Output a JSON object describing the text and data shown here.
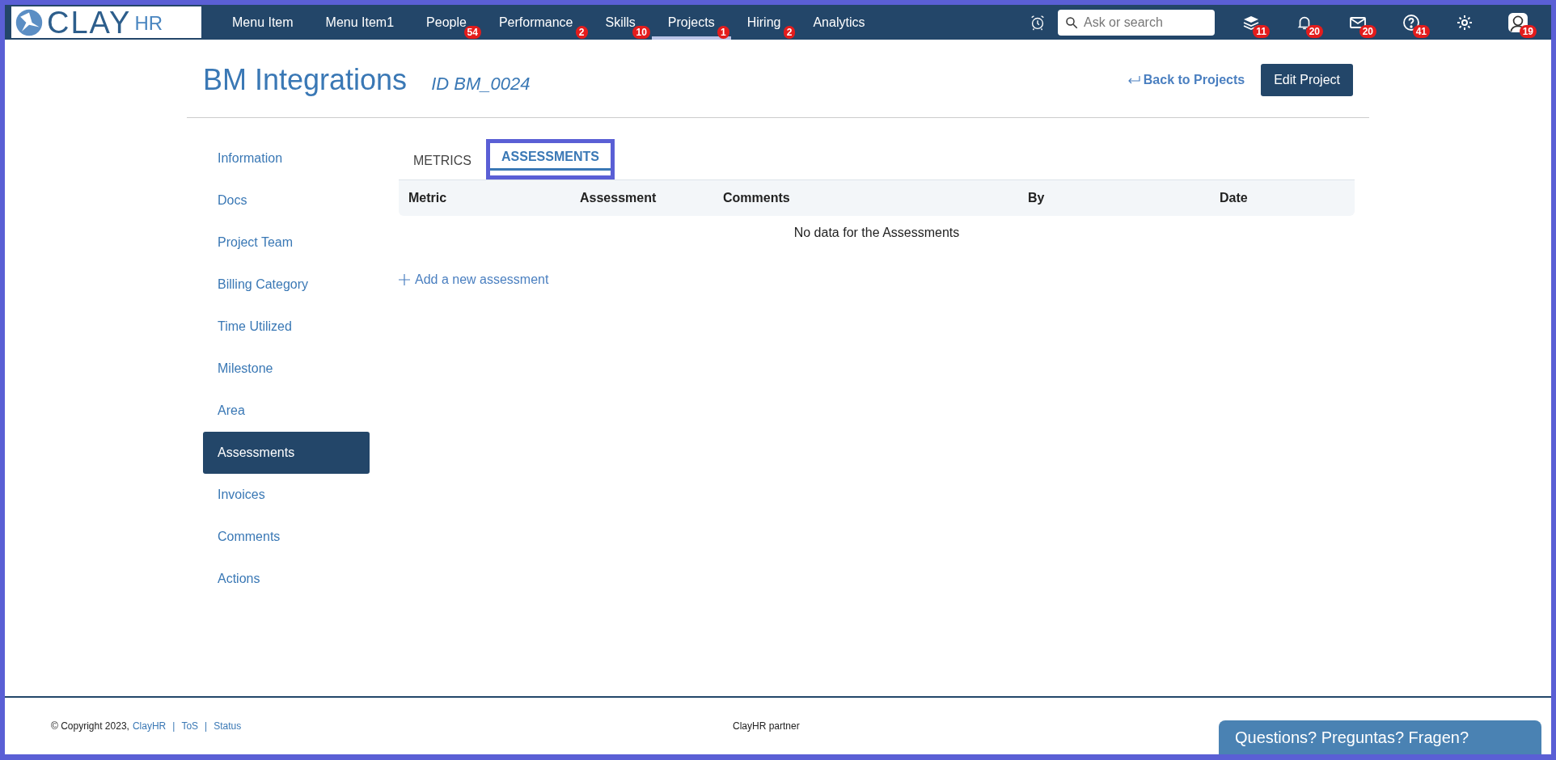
{
  "logo": {
    "word": "CLAY",
    "suffix": "HR"
  },
  "nav": [
    {
      "label": "Menu Item",
      "selected": false
    },
    {
      "label": "Menu Item1",
      "selected": false
    },
    {
      "label": "People",
      "selected": false,
      "badge": "54"
    },
    {
      "label": "Performance",
      "selected": false,
      "badge": "2"
    },
    {
      "label": "Skills",
      "selected": false,
      "badge": "10"
    },
    {
      "label": "Projects",
      "selected": true,
      "badge": "1"
    },
    {
      "label": "Hiring",
      "selected": false,
      "badge": "2"
    },
    {
      "label": "Analytics",
      "selected": false
    }
  ],
  "search": {
    "placeholder": "Ask or search"
  },
  "toolbar": [
    {
      "kind": "layers",
      "badge": "11"
    },
    {
      "kind": "bell",
      "badge": "20"
    },
    {
      "kind": "mail",
      "badge": "20"
    },
    {
      "kind": "help",
      "badge": "41"
    },
    {
      "kind": "settings"
    },
    {
      "kind": "avatar",
      "badge": "19"
    }
  ],
  "header": {
    "title": "BM Integrations",
    "id": "ID BM_0024",
    "back_link": "Back to Projects",
    "edit_button": "Edit Project"
  },
  "sidebar": [
    {
      "label": "Information",
      "selected": false
    },
    {
      "label": "Docs",
      "selected": false
    },
    {
      "label": "Project Team",
      "selected": false
    },
    {
      "label": "Billing Category",
      "selected": false
    },
    {
      "label": "Time Utilized",
      "selected": false
    },
    {
      "label": "Milestone",
      "selected": false
    },
    {
      "label": "Area",
      "selected": false
    },
    {
      "label": "Assessments",
      "selected": true
    },
    {
      "label": "Invoices",
      "selected": false
    },
    {
      "label": "Comments",
      "selected": false
    },
    {
      "label": "Actions",
      "selected": false
    }
  ],
  "tabs": [
    {
      "label": "METRICS",
      "selected": false
    },
    {
      "label": "ASSESSMENTS",
      "selected": true
    }
  ],
  "table": {
    "columns": [
      "Metric",
      "Assessment",
      "Comments",
      "By",
      "Date"
    ],
    "empty": "No data for the Assessments"
  },
  "add_link": "Add a new assessment",
  "footer": {
    "parts": [
      {
        "kind": "text",
        "text": "© Copyright 2023,"
      },
      {
        "kind": "link",
        "text": "ClayHR"
      },
      {
        "kind": "sep",
        "text": "|"
      },
      {
        "kind": "link",
        "text": "ToS"
      },
      {
        "kind": "sep",
        "text": "|"
      },
      {
        "kind": "link",
        "text": "Status"
      }
    ],
    "center": "ClayHR partner"
  },
  "chat": "Questions? Preguntas? Fragen?"
}
